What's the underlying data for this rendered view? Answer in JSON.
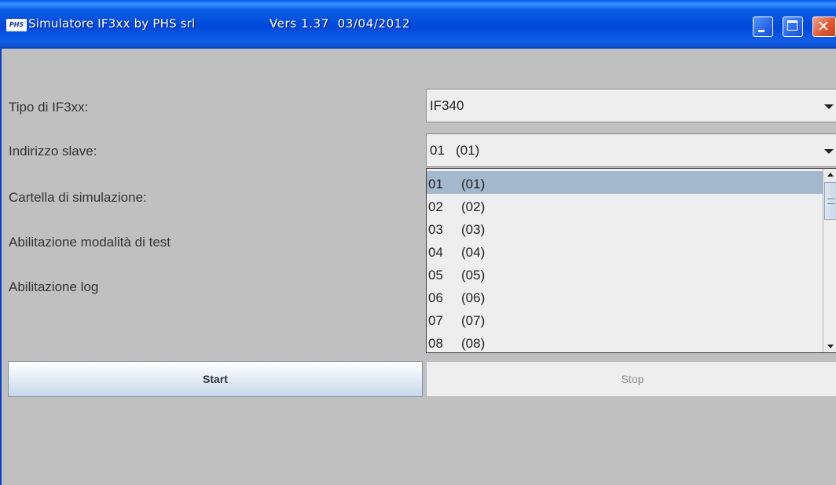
{
  "window": {
    "title": "Simulatore IF3xx by PHS srl",
    "version": "Vers 1.37  03/04/2012",
    "app_icon_text": "PHS"
  },
  "form": {
    "labels": {
      "tipo": "Tipo di IF3xx:",
      "indirizzo": "Indirizzo slave:",
      "cartella": "Cartella di simulazione:",
      "test": "Abilitazione modalità di test",
      "log": "Abilitazione log"
    },
    "tipo_value": "IF340",
    "indirizzo_value": "01   (01)"
  },
  "dropdown": {
    "items": [
      {
        "code": "01",
        "sub": "(01)"
      },
      {
        "code": "02",
        "sub": "(02)"
      },
      {
        "code": "03",
        "sub": "(03)"
      },
      {
        "code": "04",
        "sub": "(04)"
      },
      {
        "code": "05",
        "sub": "(05)"
      },
      {
        "code": "06",
        "sub": "(06)"
      },
      {
        "code": "07",
        "sub": "(07)"
      },
      {
        "code": "08",
        "sub": "(08)"
      }
    ],
    "selected_index": 0
  },
  "buttons": {
    "start": "Start",
    "stop": "Stop"
  },
  "colors": {
    "titlebar": "#0a5ee8",
    "selection": "#a3b8cc",
    "background": "#c0c0c0",
    "close": "#e05a36"
  }
}
